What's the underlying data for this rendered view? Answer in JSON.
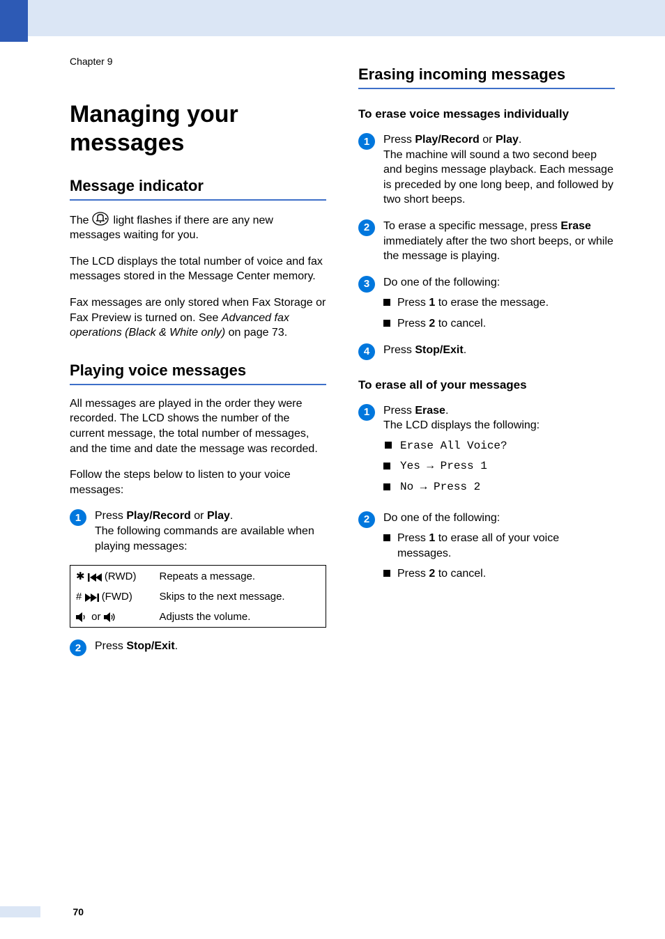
{
  "chapter": "Chapter 9",
  "page_number": "70",
  "left": {
    "h1": "Managing your messages",
    "sec1": {
      "heading": "Message indicator",
      "p1a": "The ",
      "p1b": " light flashes if there are any new messages waiting for you.",
      "p2": "The LCD displays the total number of voice and fax messages stored in the Message Center memory.",
      "p3a": "Fax messages are only stored when Fax Storage or Fax Preview is turned on. See ",
      "p3b": "Advanced fax operations (Black & White only)",
      "p3c": " on page 73."
    },
    "sec2": {
      "heading": "Playing voice messages",
      "p1": "All messages are played in the order they were recorded. The LCD shows the number of the current message, the total number of messages, and the time and date the message was recorded.",
      "p2": "Follow the steps below to listen to your voice messages:",
      "step1a": "Press ",
      "step1b": "Play/Record",
      "step1c": " or ",
      "step1d": "Play",
      "step1e": ".",
      "step1f": "The following commands are available when playing messages:",
      "tbl": {
        "r1a": " (RWD)",
        "r1b": "Repeats a message.",
        "r2a": " (FWD)",
        "r2b": "Skips to the next message.",
        "r3a": "or",
        "r3b": "Adjusts the volume."
      },
      "step2a": "Press ",
      "step2b": "Stop/Exit",
      "step2c": "."
    }
  },
  "right": {
    "h2": "Erasing incoming messages",
    "sub1": "To erase voice messages individually",
    "s1": {
      "step1a": "Press ",
      "step1b": "Play/Record",
      "step1c": " or ",
      "step1d": "Play",
      "step1e": ".",
      "step1f": "The machine will sound a two second beep and begins message playback. Each message is preceded by one long beep, and followed by two short beeps.",
      "step2a": "To erase a specific message, press ",
      "step2b": "Erase",
      "step2c": " immediately after the two short beeps, or while the message is playing.",
      "step3": "Do one of the following:",
      "step3li1a": "Press ",
      "step3li1b": "1",
      "step3li1c": " to erase the message.",
      "step3li2a": "Press ",
      "step3li2b": "2",
      "step3li2c": " to cancel.",
      "step4a": "Press ",
      "step4b": "Stop/Exit",
      "step4c": "."
    },
    "sub2": "To erase all of your messages",
    "s2": {
      "step1a": "Press ",
      "step1b": "Erase",
      "step1c": ".",
      "step1d": "The LCD displays the following:",
      "lcd1": "Erase All Voice?",
      "lcd2": "Yes  → Press 1",
      "lcd3": "No   → Press 2",
      "step2": "Do one of the following:",
      "step2li1a": "Press ",
      "step2li1b": "1",
      "step2li1c": " to erase all of your voice messages.",
      "step2li2a": "Press ",
      "step2li2b": "2",
      "step2li2c": " to cancel."
    }
  }
}
